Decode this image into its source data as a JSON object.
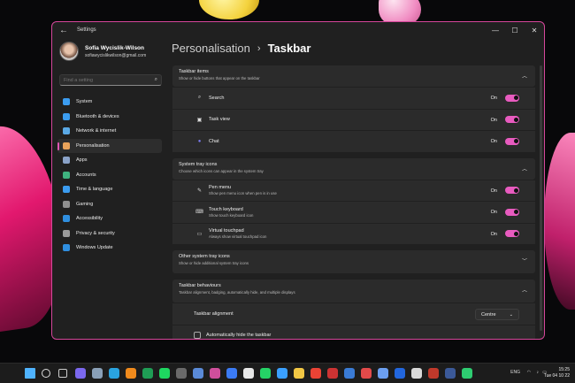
{
  "window": {
    "title": "Settings",
    "back_icon": "arrow-left-icon",
    "minimize_icon": "minimize-icon",
    "maximize_icon": "maximize-icon",
    "close_icon": "close-icon",
    "accent": "#d6479b"
  },
  "profile": {
    "name": "Sofia Wycislik-Wilson",
    "email": "sofiawycislikwilson@gmail.com"
  },
  "search": {
    "placeholder": "Find a setting",
    "icon": "search-icon"
  },
  "nav": [
    {
      "label": "System",
      "icon": "monitor-icon",
      "color": "#3b9cf0"
    },
    {
      "label": "Bluetooth & devices",
      "icon": "bluetooth-icon",
      "color": "#3b9cf0"
    },
    {
      "label": "Network & internet",
      "icon": "wifi-icon",
      "color": "#5aa9e6"
    },
    {
      "label": "Personalisation",
      "icon": "brush-icon",
      "color": "#e8a35a",
      "active": true
    },
    {
      "label": "Apps",
      "icon": "apps-icon",
      "color": "#8aa2c8"
    },
    {
      "label": "Accounts",
      "icon": "person-icon",
      "color": "#3fb27f"
    },
    {
      "label": "Time & language",
      "icon": "globe-clock-icon",
      "color": "#3b9cf0"
    },
    {
      "label": "Gaming",
      "icon": "gamepad-icon",
      "color": "#8f8f8f"
    },
    {
      "label": "Accessibility",
      "icon": "accessibility-icon",
      "color": "#2f8fe0"
    },
    {
      "label": "Privacy & security",
      "icon": "shield-icon",
      "color": "#9a9a9a"
    },
    {
      "label": "Windows Update",
      "icon": "update-icon",
      "color": "#2f8fe0"
    }
  ],
  "breadcrumb": {
    "parent": "Personalisation",
    "separator": "›",
    "current": "Taskbar"
  },
  "taskbar_items": {
    "title": "Taskbar items",
    "subtitle": "Show or hide buttons that appear on the taskbar",
    "rows": [
      {
        "label": "Search",
        "icon": "search-icon",
        "state": "On"
      },
      {
        "label": "Task view",
        "icon": "task-view-icon",
        "state": "On"
      },
      {
        "label": "Chat",
        "icon": "chat-icon",
        "state": "On"
      }
    ]
  },
  "tray_icons": {
    "title": "System tray icons",
    "subtitle": "Choose which icons can appear in the system tray",
    "rows": [
      {
        "label": "Pen menu",
        "sub": "Show pen menu icon when pen is in use",
        "icon": "pen-icon",
        "state": "On"
      },
      {
        "label": "Touch keyboard",
        "sub": "Show touch keyboard icon",
        "icon": "keyboard-icon",
        "state": "On"
      },
      {
        "label": "Virtual touchpad",
        "sub": "Always show virtual touchpad icon",
        "icon": "touchpad-icon",
        "state": "On"
      }
    ]
  },
  "other_tray": {
    "title": "Other system tray icons",
    "subtitle": "Show or hide additional system tray icons"
  },
  "behaviours": {
    "title": "Taskbar behaviours",
    "subtitle": "Taskbar alignment, badging, automatically hide, and multiple displays",
    "alignment_label": "Taskbar alignment",
    "alignment_value": "Centre",
    "autohide_label": "Automatically hide the taskbar"
  },
  "taskbar": {
    "lang": "ENG",
    "time": "15:25",
    "date": "Tue 04 10 22",
    "icons": [
      "windows-start-icon",
      "search-icon",
      "task-view-icon",
      "chat-icon",
      "settings-icon",
      "edge-icon",
      "vlc-icon",
      "excel-icon",
      "spotify-icon",
      "app-icon",
      "app-icon",
      "app-icon",
      "messenger-icon",
      "app-icon",
      "whatsapp-icon",
      "app-icon",
      "file-explorer-icon",
      "chrome-icon",
      "app-icon",
      "app-icon",
      "app-icon",
      "app-icon",
      "app-icon",
      "app-icon",
      "app-icon",
      "app-icon",
      "app-icon"
    ],
    "icon_colors": [
      "#4fb3ff",
      "#dddddd",
      "#cccccc",
      "#7b68ee",
      "#8aa0b8",
      "#2aa3e0",
      "#f08a1c",
      "#1f9d55",
      "#1ed760",
      "#6a6a6a",
      "#5a8ad8",
      "#d04f9c",
      "#3b7bf5",
      "#e8e8e8",
      "#25d366",
      "#3aa0ff",
      "#f2c744",
      "#ea4335",
      "#cc3333",
      "#3a7bd5",
      "#e24a4a",
      "#6c9ff0",
      "#2266dd",
      "#d9d9d9",
      "#c0392b",
      "#3b5998",
      "#2ecc71"
    ]
  }
}
